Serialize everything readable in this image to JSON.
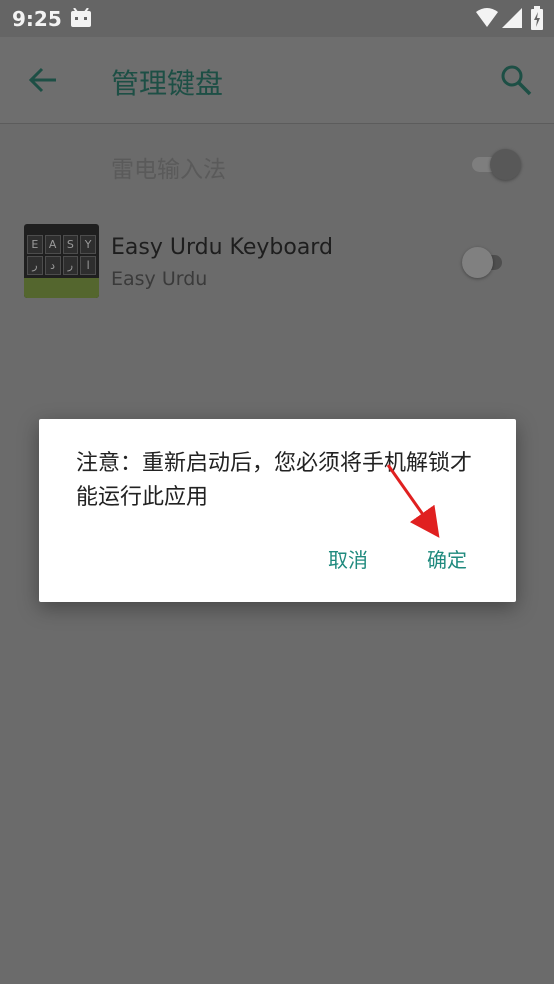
{
  "status_bar": {
    "time": "9:25"
  },
  "app_bar": {
    "title": "管理键盘"
  },
  "keyboards": [
    {
      "label": "雷电输入法",
      "enabled": true
    },
    {
      "name": "Easy Urdu Keyboard",
      "subtitle": "Easy Urdu",
      "enabled": false,
      "icon_keys": [
        "E",
        "A",
        "S",
        "Y",
        "ر",
        "د",
        "ر",
        "ا"
      ]
    }
  ],
  "dialog": {
    "message": "注意：重新启动后，您必须将手机解锁才能运行此应用",
    "cancel_label": "取消",
    "ok_label": "确定"
  },
  "colors": {
    "accent": "#1f8a7e",
    "title": "#1d4f45",
    "annotation": "#e02020"
  }
}
